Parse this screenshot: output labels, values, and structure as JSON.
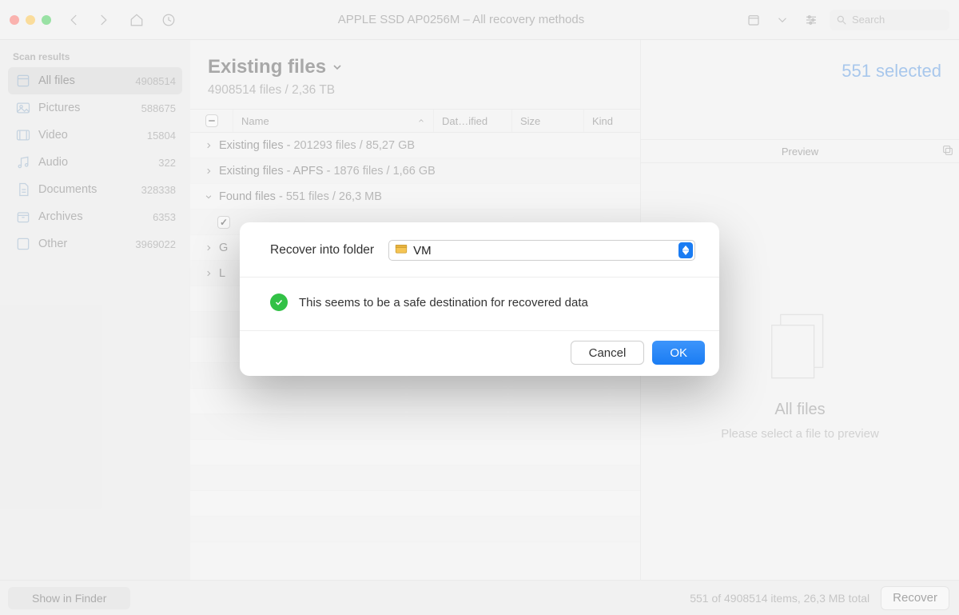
{
  "window_title": "APPLE SSD AP0256M – All recovery methods",
  "search_placeholder": "Search",
  "sidebar": {
    "heading": "Scan results",
    "items": [
      {
        "label": "All files",
        "count": "4908514"
      },
      {
        "label": "Pictures",
        "count": "588675"
      },
      {
        "label": "Video",
        "count": "15804"
      },
      {
        "label": "Audio",
        "count": "322"
      },
      {
        "label": "Documents",
        "count": "328338"
      },
      {
        "label": "Archives",
        "count": "6353"
      },
      {
        "label": "Other",
        "count": "3969022"
      }
    ]
  },
  "header": {
    "title": "Existing files",
    "subtitle": "4908514 files / 2,36 TB",
    "selected": "551 selected"
  },
  "columns": {
    "name": "Name",
    "date": "Dat…ified",
    "size": "Size",
    "kind": "Kind"
  },
  "rows": [
    {
      "expand": "right",
      "text_strong": "Existing files - ",
      "text_rest": "201293 files / 85,27 GB"
    },
    {
      "expand": "right",
      "text_strong": "Existing files - APFS - ",
      "text_rest": "1876 files / 1,66 GB"
    },
    {
      "expand": "down",
      "text_strong": "Found files - ",
      "text_rest": "551 files / 26,3 MB"
    },
    {
      "sub": true,
      "checked": true,
      "text": ""
    },
    {
      "expand": "right",
      "text_strong": "G",
      "text_rest": ""
    },
    {
      "expand": "right",
      "text_strong": "L",
      "text_rest": ""
    }
  ],
  "preview": {
    "head": "Preview",
    "title": "All files",
    "sub": "Please select a file to preview"
  },
  "footer": {
    "show_finder": "Show in Finder",
    "status": "551 of 4908514 items, 26,3 MB total",
    "recover": "Recover"
  },
  "modal": {
    "label": "Recover into folder",
    "selected": "VM",
    "safe_msg": "This seems to be a safe destination for recovered data",
    "cancel": "Cancel",
    "ok": "OK"
  }
}
